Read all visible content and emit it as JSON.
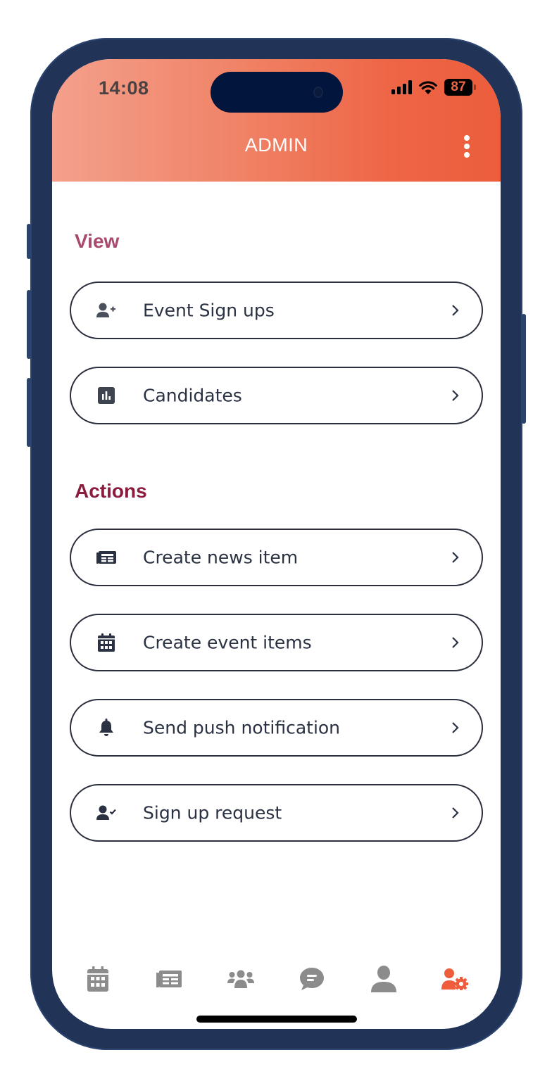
{
  "status_bar": {
    "time": "14:08",
    "battery": "87"
  },
  "header": {
    "title": "ADMIN",
    "menu_icon": "more-vertical-icon"
  },
  "sections": {
    "view": {
      "title": "View",
      "items": [
        {
          "label": "Event Sign ups",
          "icon": "user-plus-icon"
        },
        {
          "label": "Candidates",
          "icon": "chart-square-icon"
        }
      ]
    },
    "actions": {
      "title": "Actions",
      "items": [
        {
          "label": "Create news item",
          "icon": "newspaper-icon"
        },
        {
          "label": "Create event items",
          "icon": "calendar-icon"
        },
        {
          "label": "Send push notification",
          "icon": "bell-icon"
        },
        {
          "label": "Sign up request",
          "icon": "user-check-icon"
        }
      ]
    }
  },
  "tabbar": {
    "tabs": [
      {
        "name": "calendar",
        "icon": "calendar-icon",
        "active": false
      },
      {
        "name": "news",
        "icon": "newspaper-icon",
        "active": false
      },
      {
        "name": "community",
        "icon": "users-icon",
        "active": false
      },
      {
        "name": "messages",
        "icon": "chat-icon",
        "active": false
      },
      {
        "name": "profile",
        "icon": "user-icon",
        "active": false
      },
      {
        "name": "admin",
        "icon": "user-gear-icon",
        "active": true
      }
    ],
    "active_color": "#ee5d3c",
    "inactive_color": "#8c8c8c"
  },
  "colors": {
    "frame": "#213458",
    "view_title": "#a84a6e",
    "actions_title": "#8a1c3e",
    "text": "#2a3142"
  }
}
